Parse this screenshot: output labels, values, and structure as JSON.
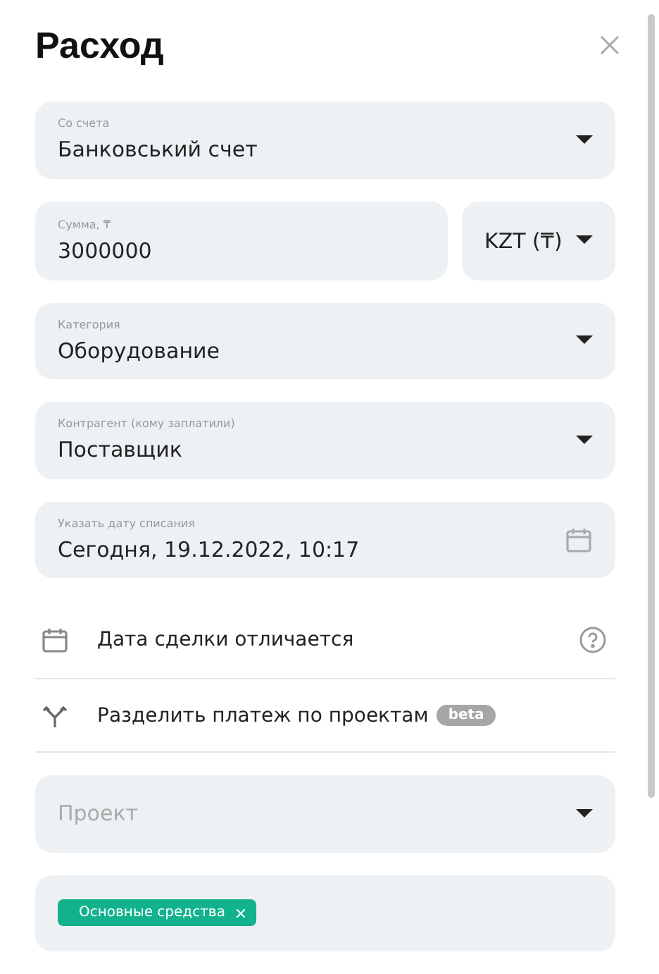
{
  "title": "Расход",
  "fields": [
    {
      "kind": "select",
      "label": "Со счета",
      "value": "Банковський счет"
    },
    {
      "kind": "amount",
      "label": "Сумма, ₸",
      "value": "3000000",
      "currency": "KZT (₸)"
    },
    {
      "kind": "select",
      "label": "Категория",
      "value": "Оборудование"
    },
    {
      "kind": "select",
      "label": "Контрагент (кому заплатили)",
      "value": "Поставщик"
    },
    {
      "kind": "date",
      "label": "Указать дату списания",
      "value": "Сегодня, 19.12.2022, 10:17"
    }
  ],
  "options": [
    {
      "kind": "date",
      "label": "Дата сделки отличается",
      "help": true
    },
    {
      "kind": "split",
      "label": "Разделить платеж по проектам",
      "badge": "beta"
    }
  ],
  "project": {
    "placeholder": "Проект"
  },
  "tags": [
    {
      "label": "Основные средства"
    }
  ]
}
